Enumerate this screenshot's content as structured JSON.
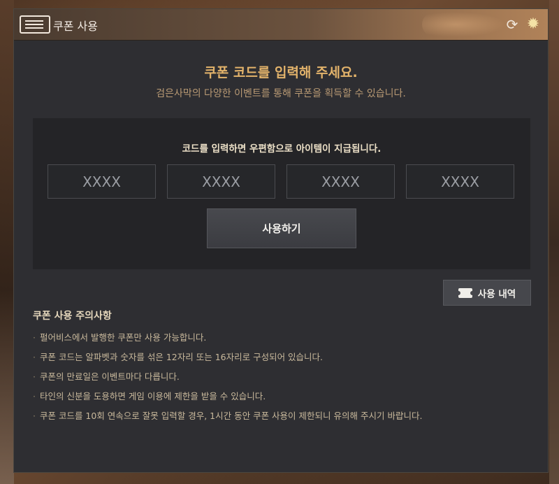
{
  "window": {
    "title": "쿠폰 사용"
  },
  "header": {
    "headline": "쿠폰 코드를 입력해 주세요.",
    "subline": "검은사막의 다양한 이벤트를 통해 쿠폰을 획득할 수 있습니다."
  },
  "code_entry": {
    "instruction": "코드를 입력하면 우편함으로 아이템이 지급됩니다.",
    "fields": [
      {
        "placeholder": "XXXX",
        "value": ""
      },
      {
        "placeholder": "XXXX",
        "value": ""
      },
      {
        "placeholder": "XXXX",
        "value": ""
      },
      {
        "placeholder": "XXXX",
        "value": ""
      }
    ],
    "submit_label": "사용하기"
  },
  "history_button": {
    "label": "사용 내역",
    "icon": "ticket-icon"
  },
  "notes": {
    "title": "쿠폰 사용 주의사항",
    "items": [
      "펄어비스에서 발행한 쿠폰만 사용 가능합니다.",
      "쿠폰 코드는 알파벳과 숫자를 섞은 12자리 또는 16자리로 구성되어 있습니다.",
      "쿠폰의 만료일은 이벤트마다 다릅니다.",
      "타인의 신분을 도용하면 게임 이용에 제한을 받을 수 있습니다.",
      "쿠폰 코드를 10회 연속으로 잘못 입력할 경우, 1시간 동안 쿠폰 사용이 제한되니 유의해 주시기 바랍니다."
    ],
    "bullet": "·"
  },
  "icons": {
    "title": "ticket-icon",
    "refresh": "refresh-icon",
    "close": "close-icon"
  },
  "colors": {
    "accent": "#e3b36b",
    "panel": "#2e2e32",
    "inner_panel": "#242427"
  }
}
